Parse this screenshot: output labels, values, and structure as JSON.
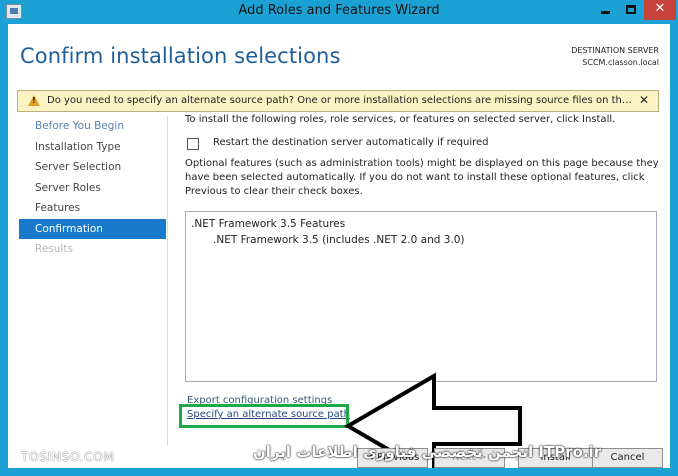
{
  "window": {
    "title": "Add Roles and Features Wizard",
    "min_icon": "minimize-icon",
    "max_icon": "maximize-icon",
    "close_glyph": "✕"
  },
  "header": {
    "page_title": "Confirm installation selections",
    "destination_label": "DESTINATION SERVER",
    "destination_server": "SCCM.classon.local"
  },
  "warning": {
    "icon": "warning-icon",
    "text": "Do you need to specify an alternate source path? One or more installation selections are missing source files on the destinati...",
    "close_glyph": "✕"
  },
  "nav": {
    "items": [
      {
        "label": "Before You Begin"
      },
      {
        "label": "Installation Type"
      },
      {
        "label": "Server Selection"
      },
      {
        "label": "Server Roles"
      },
      {
        "label": "Features"
      },
      {
        "label": "Confirmation"
      },
      {
        "label": "Results"
      }
    ],
    "active": "Confirmation"
  },
  "main": {
    "intro": "To install the following roles, role services, or features on selected server, click Install.",
    "restart_label": "Restart the destination server automatically if required",
    "restart_checked": false,
    "optional_text": "Optional features (such as administration tools) might be displayed on this page because they have been selected automatically. If you do not want to install these optional features, click Previous to clear their check boxes.",
    "features": [
      ".NET Framework 3.5 Features",
      ".NET Framework 3.5 (includes .NET 2.0 and 3.0)"
    ],
    "export_link": "Export configuration settings",
    "alternate_link": "Specify an alternate source path"
  },
  "footer": {
    "previous": "< Previous",
    "next": "Next >",
    "install": "Install",
    "cancel": "Cancel"
  },
  "watermark": {
    "left": "TOSINSO.COM",
    "right": "انجمن تخصصی فناوری اطلاعات ایران ITPro.ir"
  },
  "colors": {
    "accent": "#1979ca",
    "frame": "#1ba1d4",
    "highlight": "#1ea84a",
    "warning_bg": "#fbf3c4"
  }
}
